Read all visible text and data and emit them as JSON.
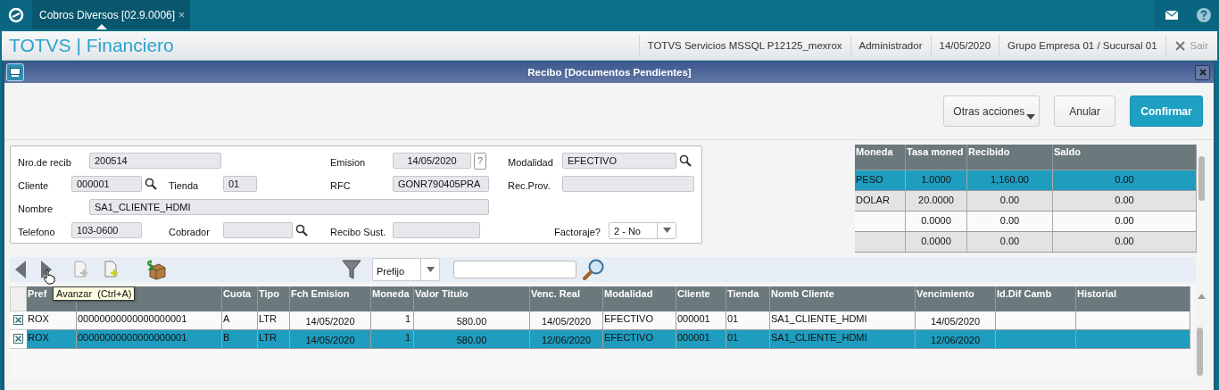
{
  "app_bar": {
    "tab": {
      "label": "Cobros Diversos [02.9.0006]",
      "close": "×",
      "selected": true
    }
  },
  "header": {
    "title": "TOTVS | Financiero",
    "info": [
      "TOTVS Servicios MSSQL P12125_mexrox",
      "Administrador",
      "14/05/2020",
      "Grupo Empresa 01 / Sucursal 01"
    ],
    "exit": "Sair"
  },
  "dialog": {
    "title": "Recibo [Documentos Pendientes]",
    "actions": [
      {
        "label": "Otras acciones",
        "kind": "menu"
      },
      {
        "label": "Anular",
        "kind": "default"
      },
      {
        "label": "Confirmar",
        "kind": "primary"
      }
    ]
  },
  "form": {
    "rows": [
      [
        {
          "label": "Nro.de recib",
          "value": "200514",
          "kind": "text"
        },
        null,
        {
          "label": "Emision",
          "value": "14/05/2020",
          "kind": "date",
          "help": "?"
        },
        {
          "label": "Modalidad",
          "value": "EFECTIVO",
          "kind": "lookup"
        }
      ],
      [
        {
          "label": "Cliente",
          "value": "000001",
          "kind": "lookup"
        },
        {
          "label": "Tienda",
          "value": "01",
          "kind": "text"
        },
        {
          "label": "RFC",
          "value": "GONR790405PRA",
          "kind": "text"
        },
        {
          "label": "Rec.Prov.",
          "kind": "text"
        }
      ],
      [
        {
          "label": "Nombre",
          "value": "SA1_CLIENTE_HDMI",
          "kind": "text"
        }
      ],
      [
        {
          "label": "Telefono",
          "value": "103-0600",
          "kind": "text"
        },
        {
          "label": "Cobrador",
          "kind": "lookup"
        },
        {
          "label": "Recibo Sust.",
          "kind": "text"
        },
        {
          "label": "Factoraje?",
          "value": "2 - No",
          "kind": "select"
        }
      ]
    ]
  },
  "currency_table": {
    "columns": [
      "Moneda",
      "Tasa moned",
      "Recibido",
      "Saldo"
    ],
    "rows": [
      {
        "moneda": "PESO",
        "tasa": "1.0000",
        "recibido": "1,160.00",
        "saldo": "0.00",
        "selected": true
      },
      {
        "moneda": "DOLAR",
        "tasa": "20.0000",
        "recibido": "0.00",
        "saldo": "0.00",
        "selected": false
      },
      {
        "tasa": "0.0000",
        "recibido": "0.00",
        "saldo": "0.00",
        "selected": false
      },
      {
        "tasa": "0.0000",
        "recibido": "0.00",
        "saldo": "0.00",
        "selected": false
      }
    ]
  },
  "toolbar": {
    "filter_field": {
      "value": "Prefijo"
    },
    "tooltip": "Avanzar  (Ctrl+A)"
  },
  "grid": {
    "columns": [
      {
        "label": "Pref"
      },
      {},
      {
        "label": "Cuota"
      },
      {
        "label": "Tipo"
      },
      {
        "label": "Fch Emision"
      },
      {
        "label": "Moneda"
      },
      {
        "label": "Valor Titulo"
      },
      {
        "label": "Venc. Real"
      },
      {
        "label": "Modalidad"
      },
      {
        "label": "Cliente"
      },
      {
        "label": "Tienda"
      },
      {
        "label": "Nomb Cliente"
      },
      {
        "label": "Vencimiento"
      },
      {
        "label": "Id.Dif Camb"
      },
      {
        "label": "Historial"
      }
    ],
    "rows": [
      {
        "checked": true,
        "selected": false,
        "cells": [
          "ROX",
          "00000000000000000001",
          "A",
          "LTR",
          "14/05/2020",
          "1",
          "580.00",
          "14/05/2020",
          "EFECTIVO",
          "000001",
          "01",
          "SA1_CLIENTE_HDMI",
          "14/05/2020"
        ]
      },
      {
        "checked": true,
        "selected": true,
        "cells": [
          "ROX",
          "00000000000000000001",
          "B",
          "LTR",
          "14/05/2020",
          "1",
          "580.00",
          "12/06/2020",
          "EFECTIVO",
          "000001",
          "01",
          "SA1_CLIENTE_HDMI",
          "12/06/2020"
        ]
      }
    ]
  }
}
